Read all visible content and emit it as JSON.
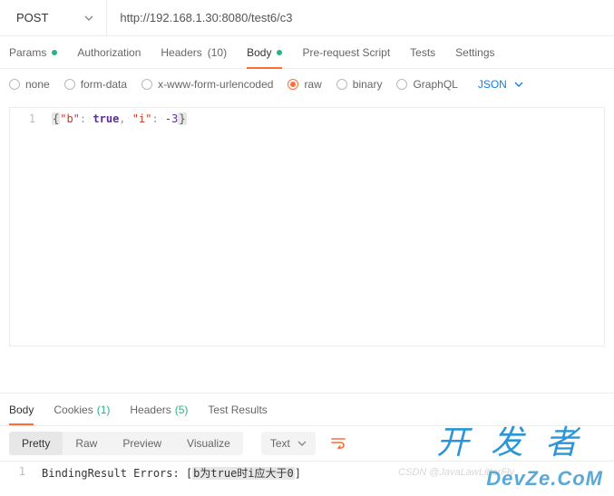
{
  "request": {
    "method": "POST",
    "url": "http://192.168.1.30:8080/test6/c3"
  },
  "req_tabs": {
    "params": "Params",
    "auth": "Authorization",
    "headers": "Headers",
    "headers_count": "(10)",
    "body": "Body",
    "pre": "Pre-request Script",
    "tests": "Tests",
    "settings": "Settings"
  },
  "body_types": {
    "none": "none",
    "formdata": "form-data",
    "xwww": "x-www-form-urlencoded",
    "raw": "raw",
    "binary": "binary",
    "graphql": "GraphQL",
    "format": "JSON"
  },
  "editor": {
    "line_no": "1",
    "open": "{",
    "k1": "\"b\"",
    "colon1": ":",
    "v1": "true",
    "comma": ",",
    "k2": "\"i\"",
    "colon2": ":",
    "v2": "-3",
    "close": "}"
  },
  "resp_tabs": {
    "body": "Body",
    "cookies": "Cookies",
    "cookies_count": "(1)",
    "headers": "Headers",
    "headers_count": "(5)",
    "test": "Test Results"
  },
  "resp_ctrl": {
    "pretty": "Pretty",
    "raw": "Raw",
    "preview": "Preview",
    "visualize": "Visualize",
    "format": "Text"
  },
  "resp_body": {
    "line_no": "1",
    "prefix": "BindingResult Errors: [",
    "hl": "b为true时i应大于0",
    "suffix": "]"
  },
  "watermark": {
    "cn": "开发者",
    "en": "DevZe.CoM",
    "csdn": "CSDN @JavaLawLitterFly"
  }
}
